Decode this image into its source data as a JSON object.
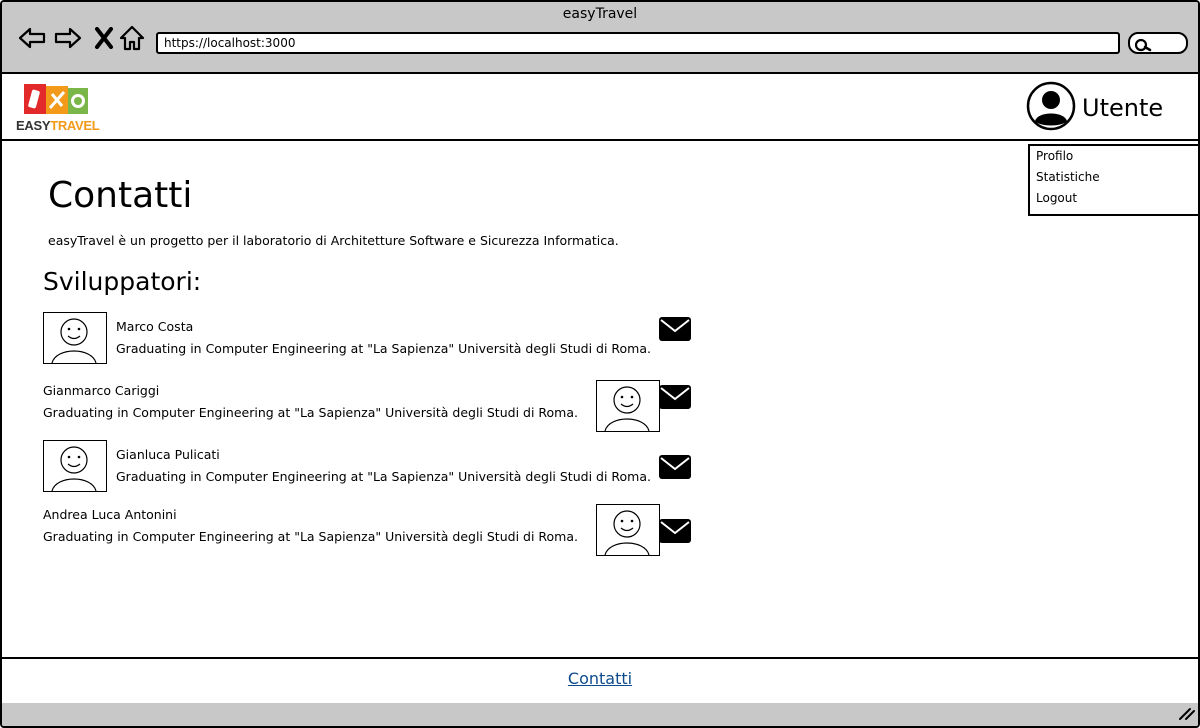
{
  "window": {
    "title": "easyTravel"
  },
  "browser": {
    "address": "https://localhost:3000",
    "icons": [
      "back-icon",
      "forward-icon",
      "close-icon",
      "home-icon",
      "search-icon"
    ]
  },
  "header": {
    "logo": {
      "easy": "EASY",
      "travel": "TRAVEL"
    },
    "user_label": "Utente"
  },
  "user_menu": {
    "items": [
      "Profilo",
      "Statistiche",
      "Logout"
    ]
  },
  "main": {
    "title": "Contatti",
    "description": "easyTravel è un progetto per il laboratorio di Architetture Software e Sicurezza Informatica.",
    "developers_heading": "Sviluppatori:",
    "developers": [
      {
        "name": "Marco Costa",
        "bio": "Graduating in Computer Engineering at \"La Sapienza\" Università degli Studi di Roma.",
        "avatar_side": "left"
      },
      {
        "name": "Gianmarco Cariggi",
        "bio": "Graduating in Computer Engineering at \"La Sapienza\" Università degli Studi di Roma.",
        "avatar_side": "right"
      },
      {
        "name": "Gianluca Pulicati",
        "bio": "Graduating in Computer Engineering at \"La Sapienza\" Università degli Studi di Roma.",
        "avatar_side": "left"
      },
      {
        "name": "Andrea Luca Antonini",
        "bio": "Graduating in Computer Engineering at \"La Sapienza\" Università degli Studi di Roma.",
        "avatar_side": "right"
      }
    ]
  },
  "footer": {
    "link": "Contatti"
  },
  "colors": {
    "chrome": "#c8c8c8",
    "link": "#0b4a8c",
    "logo_orange": "#f39a1b"
  }
}
